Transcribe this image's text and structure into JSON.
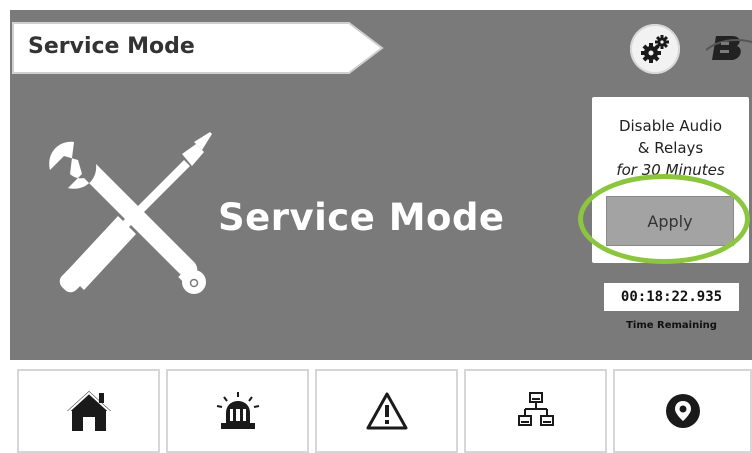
{
  "header": {
    "title": "Service Mode"
  },
  "main": {
    "heading": "Service Mode"
  },
  "disable_panel": {
    "line1": "Disable Audio",
    "line2": "& Relays",
    "line3": "for 30 Minutes",
    "apply_label": "Apply"
  },
  "timer": {
    "value": "00:18:22.935",
    "label": "Time Remaining"
  },
  "nav": {
    "items": [
      {
        "icon": "home-icon"
      },
      {
        "icon": "alarm-beacon-icon"
      },
      {
        "icon": "warning-icon"
      },
      {
        "icon": "network-icon"
      },
      {
        "icon": "location-pin-icon"
      }
    ]
  },
  "colors": {
    "background": "#7a7a7a",
    "highlight": "#8cc63f",
    "apply_button": "#a3a3a3"
  }
}
